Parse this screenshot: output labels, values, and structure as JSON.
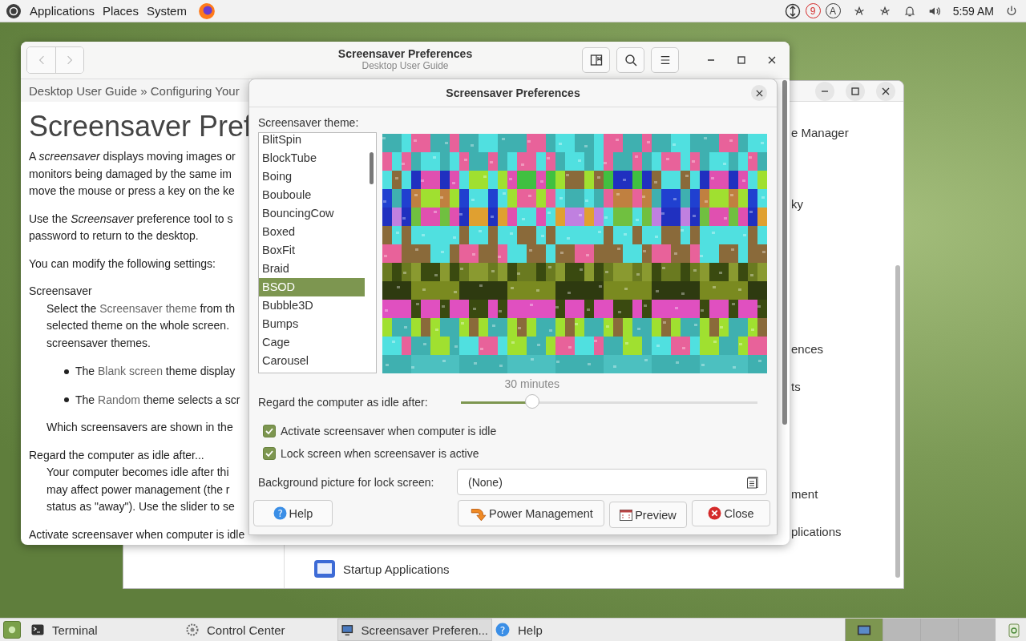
{
  "top_panel": {
    "menus": [
      "Applications",
      "Places",
      "System"
    ],
    "badges": [
      {
        "text": "9",
        "color": "#d42a2a"
      },
      {
        "text": "A",
        "color": "#3c3c3c"
      }
    ],
    "clock": "5:59 AM"
  },
  "control_center": {
    "items": [
      {
        "text": "e Manager",
        "kind": "fragment"
      },
      {
        "text": "ky",
        "kind": "fragment"
      },
      {
        "text": "ences",
        "kind": "fragment"
      },
      {
        "text": "ts",
        "kind": "fragment"
      },
      {
        "text": "ment",
        "kind": "fragment"
      },
      {
        "text": "plications",
        "kind": "fragment"
      },
      {
        "text": "Startup Applications",
        "kind": "full"
      }
    ]
  },
  "help_window": {
    "title": "Screensaver Preferences",
    "subtitle": "Desktop User Guide",
    "breadcrumb": "Desktop User Guide » Configuring Your",
    "heading": "Screensaver Pref",
    "blocks": [
      {
        "kind": "p",
        "lines": [
          "A *screensaver* displays moving images or",
          "monitors being damaged by the same im",
          "move the mouse or press a key on the ke"
        ]
      },
      {
        "kind": "p",
        "lines": [
          "Use the *Screensaver* preference tool to s",
          "password to return to the desktop."
        ]
      },
      {
        "kind": "p",
        "lines": [
          "You can modify the following settings:"
        ]
      },
      {
        "kind": "term",
        "lines": [
          "Screensaver"
        ]
      },
      {
        "kind": "dd",
        "lines": [
          {
            "before": "Select the ",
            "link": "Screensaver theme",
            "after": " from th"
          },
          "selected theme on the whole screen.",
          "screensaver themes."
        ]
      },
      {
        "kind": "bullet",
        "lines": [
          {
            "before": "The ",
            "link": "Blank screen",
            "after": " theme display"
          }
        ]
      },
      {
        "kind": "bullet",
        "lines": [
          {
            "before": "The ",
            "link": "Random",
            "after": " theme selects a scr"
          }
        ]
      },
      {
        "kind": "dd",
        "lines": [
          "Which screensavers are shown in the"
        ]
      },
      {
        "kind": "term",
        "lines": [
          "Regard the computer as idle after..."
        ]
      },
      {
        "kind": "dd",
        "lines": [
          "Your computer becomes idle after thi",
          "may affect power management (the r",
          "status as \"away\"). Use the slider to se"
        ]
      },
      {
        "kind": "term",
        "lines": [
          "Activate screensaver when computer is idle"
        ]
      }
    ]
  },
  "dialog": {
    "title": "Screensaver Preferences",
    "theme_label": "Screensaver theme:",
    "themes": [
      {
        "name": "BlitSpin",
        "selected": false
      },
      {
        "name": "BlockTube",
        "selected": false
      },
      {
        "name": "Boing",
        "selected": false
      },
      {
        "name": "Bouboule",
        "selected": false
      },
      {
        "name": "BouncingCow",
        "selected": false
      },
      {
        "name": "Boxed",
        "selected": false
      },
      {
        "name": "BoxFit",
        "selected": false
      },
      {
        "name": "Braid",
        "selected": false
      },
      {
        "name": "BSOD",
        "selected": true
      },
      {
        "name": "Bubble3D",
        "selected": false
      },
      {
        "name": "Bumps",
        "selected": false
      },
      {
        "name": "Cage",
        "selected": false
      },
      {
        "name": "Carousel",
        "selected": false
      }
    ],
    "idle": {
      "label": "Regard the computer as idle after:",
      "reading": "30 minutes",
      "level": 0.24
    },
    "checkboxes": [
      {
        "label": "Activate screensaver when computer is idle",
        "checked": true
      },
      {
        "label": "Lock screen when screensaver is active",
        "checked": true
      }
    ],
    "background": {
      "label": "Background picture for lock screen:",
      "value": "(None)"
    },
    "buttons": [
      {
        "label": "Help",
        "kind": "help",
        "glyph": "?"
      },
      {
        "label": "Power Management",
        "kind": "power"
      },
      {
        "label": "Preview",
        "kind": "preview"
      },
      {
        "label": "Close",
        "kind": "close"
      }
    ]
  },
  "taskbar": {
    "tasks": [
      {
        "label": "Terminal",
        "kind": "terminal",
        "selected": false
      },
      {
        "label": "Control Center",
        "kind": "control",
        "selected": false
      },
      {
        "label": "Screensaver Preferen...",
        "kind": "screen",
        "selected": true
      },
      {
        "label": "Help",
        "kind": "help",
        "glyph": "?",
        "selected": false
      }
    ],
    "workspaces": [
      {
        "selected": true
      },
      {
        "selected": false
      },
      {
        "selected": false
      },
      {
        "selected": false
      }
    ]
  }
}
